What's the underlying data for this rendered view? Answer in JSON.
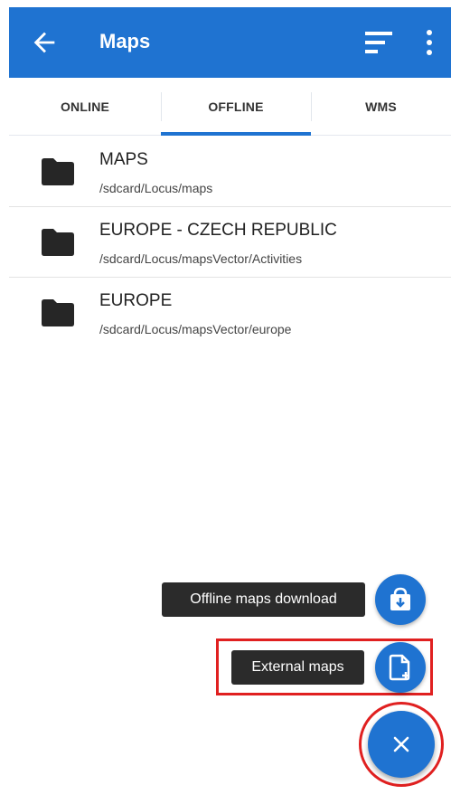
{
  "app_bar": {
    "title": "Maps",
    "back_icon": "arrow-back-icon",
    "sort_icon": "sort-icon",
    "more_icon": "more-vert-icon",
    "color": "#1f73d1"
  },
  "tabs": [
    {
      "label": "ONLINE",
      "selected": false
    },
    {
      "label": "OFFLINE",
      "selected": true
    },
    {
      "label": "WMS",
      "selected": false
    }
  ],
  "list": {
    "items": [
      {
        "name": "MAPS",
        "path": "/sdcard/Locus/maps",
        "icon": "folder-icon"
      },
      {
        "name": "EUROPE - CZECH REPUBLIC",
        "path": "/sdcard/Locus/mapsVector/Activities",
        "icon": "folder-icon"
      },
      {
        "name": "EUROPE",
        "path": "/sdcard/Locus/mapsVector/europe",
        "icon": "folder-icon"
      }
    ]
  },
  "fab_menu": {
    "offline_download_label": "Offline maps download",
    "external_maps_label": "External maps",
    "offline_download_icon": "store-download-icon",
    "external_maps_icon": "add-file-icon",
    "main_icon": "close-icon",
    "highlight_color": "#e02020"
  }
}
